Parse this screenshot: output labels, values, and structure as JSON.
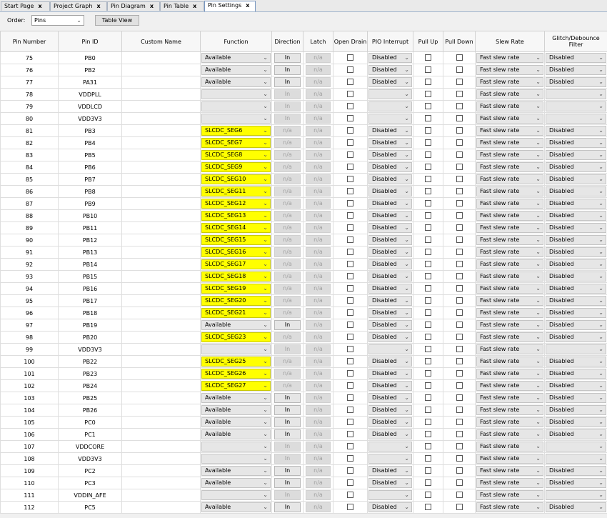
{
  "tabs": [
    {
      "label": "Start Page"
    },
    {
      "label": "Project Graph"
    },
    {
      "label": "Pin Diagram"
    },
    {
      "label": "Pin Table"
    },
    {
      "label": "Pin Settings"
    }
  ],
  "close_glyph": "x",
  "toolbar": {
    "order_label": "Order:",
    "order_value": "Pins",
    "table_view_label": "Table View"
  },
  "columns": [
    "Pin Number",
    "Pin ID",
    "Custom Name",
    "Function",
    "Direction",
    "Latch",
    "Open Drain",
    "PIO Interrupt",
    "Pull Up",
    "Pull Down",
    "Slew Rate",
    "Glitch/Debounce Filter"
  ],
  "rows": [
    {
      "num": "75",
      "id": "PB0",
      "fn": "Available",
      "dir": "In",
      "latch": "n/a",
      "int": "Disabled",
      "slew": "Fast slew rate",
      "glitch": "Disabled"
    },
    {
      "num": "76",
      "id": "PB2",
      "fn": "Available",
      "dir": "In",
      "latch": "n/a",
      "int": "Disabled",
      "slew": "Fast slew rate",
      "glitch": "Disabled"
    },
    {
      "num": "77",
      "id": "PA31",
      "fn": "Available",
      "dir": "In",
      "latch": "n/a",
      "int": "Disabled",
      "slew": "Fast slew rate",
      "glitch": "Disabled"
    },
    {
      "num": "78",
      "id": "VDDPLL",
      "fn": "",
      "dir": "In",
      "latch": "n/a",
      "int": "",
      "slew": "Fast slew rate",
      "glitch": ""
    },
    {
      "num": "79",
      "id": "VDDLCD",
      "fn": "",
      "dir": "In",
      "latch": "n/a",
      "int": "",
      "slew": "Fast slew rate",
      "glitch": ""
    },
    {
      "num": "80",
      "id": "VDD3V3",
      "fn": "",
      "dir": "In",
      "latch": "n/a",
      "int": "",
      "slew": "Fast slew rate",
      "glitch": ""
    },
    {
      "num": "81",
      "id": "PB3",
      "fn": "SLCDC_SEG6",
      "dir": "n/a",
      "latch": "n/a",
      "int": "Disabled",
      "slew": "Fast slew rate",
      "glitch": "Disabled"
    },
    {
      "num": "82",
      "id": "PB4",
      "fn": "SLCDC_SEG7",
      "dir": "n/a",
      "latch": "n/a",
      "int": "Disabled",
      "slew": "Fast slew rate",
      "glitch": "Disabled"
    },
    {
      "num": "83",
      "id": "PB5",
      "fn": "SLCDC_SEG8",
      "dir": "n/a",
      "latch": "n/a",
      "int": "Disabled",
      "slew": "Fast slew rate",
      "glitch": "Disabled"
    },
    {
      "num": "84",
      "id": "PB6",
      "fn": "SLCDC_SEG9",
      "dir": "n/a",
      "latch": "n/a",
      "int": "Disabled",
      "slew": "Fast slew rate",
      "glitch": "Disabled"
    },
    {
      "num": "85",
      "id": "PB7",
      "fn": "SLCDC_SEG10",
      "dir": "n/a",
      "latch": "n/a",
      "int": "Disabled",
      "slew": "Fast slew rate",
      "glitch": "Disabled"
    },
    {
      "num": "86",
      "id": "PB8",
      "fn": "SLCDC_SEG11",
      "dir": "n/a",
      "latch": "n/a",
      "int": "Disabled",
      "slew": "Fast slew rate",
      "glitch": "Disabled"
    },
    {
      "num": "87",
      "id": "PB9",
      "fn": "SLCDC_SEG12",
      "dir": "n/a",
      "latch": "n/a",
      "int": "Disabled",
      "slew": "Fast slew rate",
      "glitch": "Disabled"
    },
    {
      "num": "88",
      "id": "PB10",
      "fn": "SLCDC_SEG13",
      "dir": "n/a",
      "latch": "n/a",
      "int": "Disabled",
      "slew": "Fast slew rate",
      "glitch": "Disabled"
    },
    {
      "num": "89",
      "id": "PB11",
      "fn": "SLCDC_SEG14",
      "dir": "n/a",
      "latch": "n/a",
      "int": "Disabled",
      "slew": "Fast slew rate",
      "glitch": "Disabled"
    },
    {
      "num": "90",
      "id": "PB12",
      "fn": "SLCDC_SEG15",
      "dir": "n/a",
      "latch": "n/a",
      "int": "Disabled",
      "slew": "Fast slew rate",
      "glitch": "Disabled"
    },
    {
      "num": "91",
      "id": "PB13",
      "fn": "SLCDC_SEG16",
      "dir": "n/a",
      "latch": "n/a",
      "int": "Disabled",
      "slew": "Fast slew rate",
      "glitch": "Disabled"
    },
    {
      "num": "92",
      "id": "PB14",
      "fn": "SLCDC_SEG17",
      "dir": "n/a",
      "latch": "n/a",
      "int": "Disabled",
      "slew": "Fast slew rate",
      "glitch": "Disabled"
    },
    {
      "num": "93",
      "id": "PB15",
      "fn": "SLCDC_SEG18",
      "dir": "n/a",
      "latch": "n/a",
      "int": "Disabled",
      "slew": "Fast slew rate",
      "glitch": "Disabled"
    },
    {
      "num": "94",
      "id": "PB16",
      "fn": "SLCDC_SEG19",
      "dir": "n/a",
      "latch": "n/a",
      "int": "Disabled",
      "slew": "Fast slew rate",
      "glitch": "Disabled"
    },
    {
      "num": "95",
      "id": "PB17",
      "fn": "SLCDC_SEG20",
      "dir": "n/a",
      "latch": "n/a",
      "int": "Disabled",
      "slew": "Fast slew rate",
      "glitch": "Disabled"
    },
    {
      "num": "96",
      "id": "PB18",
      "fn": "SLCDC_SEG21",
      "dir": "n/a",
      "latch": "n/a",
      "int": "Disabled",
      "slew": "Fast slew rate",
      "glitch": "Disabled"
    },
    {
      "num": "97",
      "id": "PB19",
      "fn": "Available",
      "dir": "In",
      "latch": "n/a",
      "int": "Disabled",
      "slew": "Fast slew rate",
      "glitch": "Disabled"
    },
    {
      "num": "98",
      "id": "PB20",
      "fn": "SLCDC_SEG23",
      "dir": "n/a",
      "latch": "n/a",
      "int": "Disabled",
      "slew": "Fast slew rate",
      "glitch": "Disabled"
    },
    {
      "num": "99",
      "id": "VDD3V3",
      "fn": "",
      "dir": "In",
      "latch": "n/a",
      "int": "",
      "slew": "Fast slew rate",
      "glitch": ""
    },
    {
      "num": "100",
      "id": "PB22",
      "fn": "SLCDC_SEG25",
      "dir": "n/a",
      "latch": "n/a",
      "int": "Disabled",
      "slew": "Fast slew rate",
      "glitch": "Disabled"
    },
    {
      "num": "101",
      "id": "PB23",
      "fn": "SLCDC_SEG26",
      "dir": "n/a",
      "latch": "n/a",
      "int": "Disabled",
      "slew": "Fast slew rate",
      "glitch": "Disabled"
    },
    {
      "num": "102",
      "id": "PB24",
      "fn": "SLCDC_SEG27",
      "dir": "n/a",
      "latch": "n/a",
      "int": "Disabled",
      "slew": "Fast slew rate",
      "glitch": "Disabled"
    },
    {
      "num": "103",
      "id": "PB25",
      "fn": "Available",
      "dir": "In",
      "latch": "n/a",
      "int": "Disabled",
      "slew": "Fast slew rate",
      "glitch": "Disabled"
    },
    {
      "num": "104",
      "id": "PB26",
      "fn": "Available",
      "dir": "In",
      "latch": "n/a",
      "int": "Disabled",
      "slew": "Fast slew rate",
      "glitch": "Disabled"
    },
    {
      "num": "105",
      "id": "PC0",
      "fn": "Available",
      "dir": "In",
      "latch": "n/a",
      "int": "Disabled",
      "slew": "Fast slew rate",
      "glitch": "Disabled"
    },
    {
      "num": "106",
      "id": "PC1",
      "fn": "Available",
      "dir": "In",
      "latch": "n/a",
      "int": "Disabled",
      "slew": "Fast slew rate",
      "glitch": "Disabled"
    },
    {
      "num": "107",
      "id": "VDDCORE",
      "fn": "",
      "dir": "In",
      "latch": "n/a",
      "int": "",
      "slew": "Fast slew rate",
      "glitch": ""
    },
    {
      "num": "108",
      "id": "VDD3V3",
      "fn": "",
      "dir": "In",
      "latch": "n/a",
      "int": "",
      "slew": "Fast slew rate",
      "glitch": ""
    },
    {
      "num": "109",
      "id": "PC2",
      "fn": "Available",
      "dir": "In",
      "latch": "n/a",
      "int": "Disabled",
      "slew": "Fast slew rate",
      "glitch": "Disabled"
    },
    {
      "num": "110",
      "id": "PC3",
      "fn": "Available",
      "dir": "In",
      "latch": "n/a",
      "int": "Disabled",
      "slew": "Fast slew rate",
      "glitch": "Disabled"
    },
    {
      "num": "111",
      "id": "VDDIN_AFE",
      "fn": "",
      "dir": "In",
      "latch": "n/a",
      "int": "",
      "slew": "Fast slew rate",
      "glitch": ""
    },
    {
      "num": "112",
      "id": "PC5",
      "fn": "Available",
      "dir": "In",
      "latch": "n/a",
      "int": "Disabled",
      "slew": "Fast slew rate",
      "glitch": "Disabled"
    }
  ],
  "colors": {
    "highlight": "#ffff00",
    "active_tab_border": "#7a98c0"
  },
  "icons": {
    "dropdown": "chevron-down-icon",
    "checkbox": "checkbox-icon",
    "close": "close-icon"
  }
}
